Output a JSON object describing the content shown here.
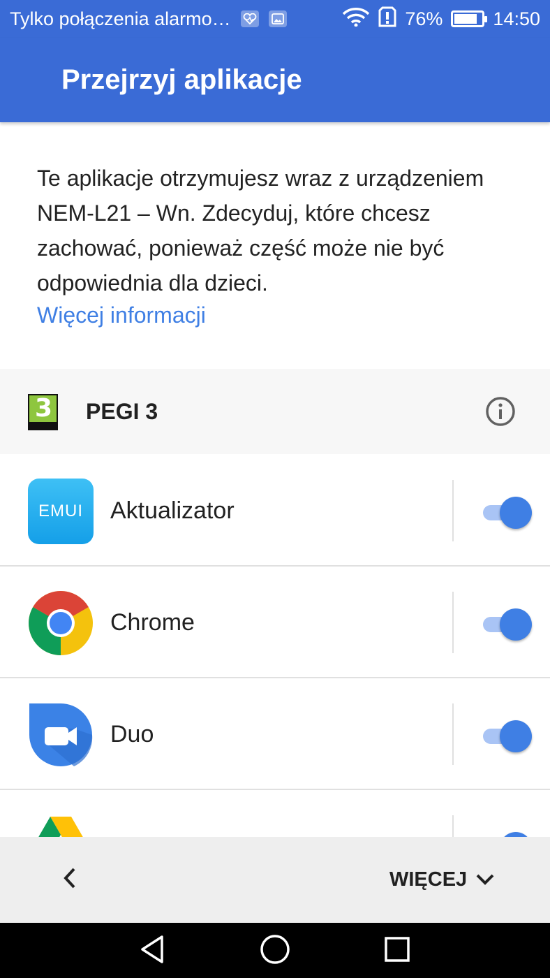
{
  "status_bar": {
    "carrier_text": "Tylko połączenia alarmo…",
    "notification_icons": [
      "health-notification-icon",
      "image-notification-icon"
    ],
    "battery_percent": "76%",
    "battery_level": 0.76,
    "time": "14:50"
  },
  "header": {
    "title": "Przejrzyj aplikacje"
  },
  "description": {
    "text": "Te aplikacje otrzymujesz wraz z urządzeniem NEM-L21 – Wn. Zdecyduj, które chcesz zachować, ponieważ część może nie być odpowiednia dla dzieci.",
    "link_label": "Więcej informacji"
  },
  "rating": {
    "label": "PEGI 3",
    "badge_number": "3"
  },
  "apps": [
    {
      "name": "Aktualizator",
      "icon": "emui-icon",
      "icon_text": "EMUI",
      "enabled": true
    },
    {
      "name": "Chrome",
      "icon": "chrome-icon",
      "enabled": true
    },
    {
      "name": "Duo",
      "icon": "duo-icon",
      "enabled": true
    },
    {
      "name": "",
      "icon": "drive-icon",
      "enabled": true
    }
  ],
  "footer": {
    "more_label": "WIĘCEJ"
  },
  "colors": {
    "primary": "#3a6bd6",
    "accent": "#3f7fe4",
    "link": "#3f7fe4",
    "toggle_track": "#a9c4f5"
  }
}
